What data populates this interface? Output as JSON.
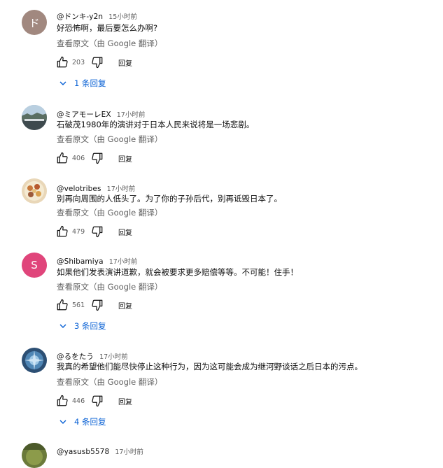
{
  "translate_label": "查看原文（由 Google 翻译）",
  "reply_label": "回复",
  "comments": [
    {
      "author": "@ドンキ-y2n",
      "time": "15小时前",
      "text": "好恐怖啊，最后要怎么办啊?",
      "likes": "203",
      "avatar_letter": "ド",
      "avatar_color": "#a1887f",
      "replies": "1 条回复"
    },
    {
      "author": "@ミアモーレEX",
      "time": "17小时前",
      "text": "石破茂1980年的演讲对于日本人民来说将是一场悲剧。",
      "likes": "406"
    },
    {
      "author": "@velotribes",
      "time": "17小时前",
      "text": "别再向周围的人低头了。为了你的子孙后代，别再诋毁日本了。",
      "likes": "479"
    },
    {
      "author": "@Shibamiya",
      "time": "17小时前",
      "text": "如果他们发表演讲道歉，就会被要求更多赔偿等等。不可能！住手！",
      "likes": "561",
      "avatar_letter": "S",
      "avatar_color": "#e0457b",
      "replies": "3 条回复"
    },
    {
      "author": "@るをたう",
      "time": "17小时前",
      "text": "我真的希望他们能尽快停止这种行为，因为这可能会成为继河野谈话之后日本的污点。",
      "likes": "446",
      "replies": "4 条回复"
    },
    {
      "author": "@yasusb5578",
      "time": "17小时前"
    }
  ]
}
